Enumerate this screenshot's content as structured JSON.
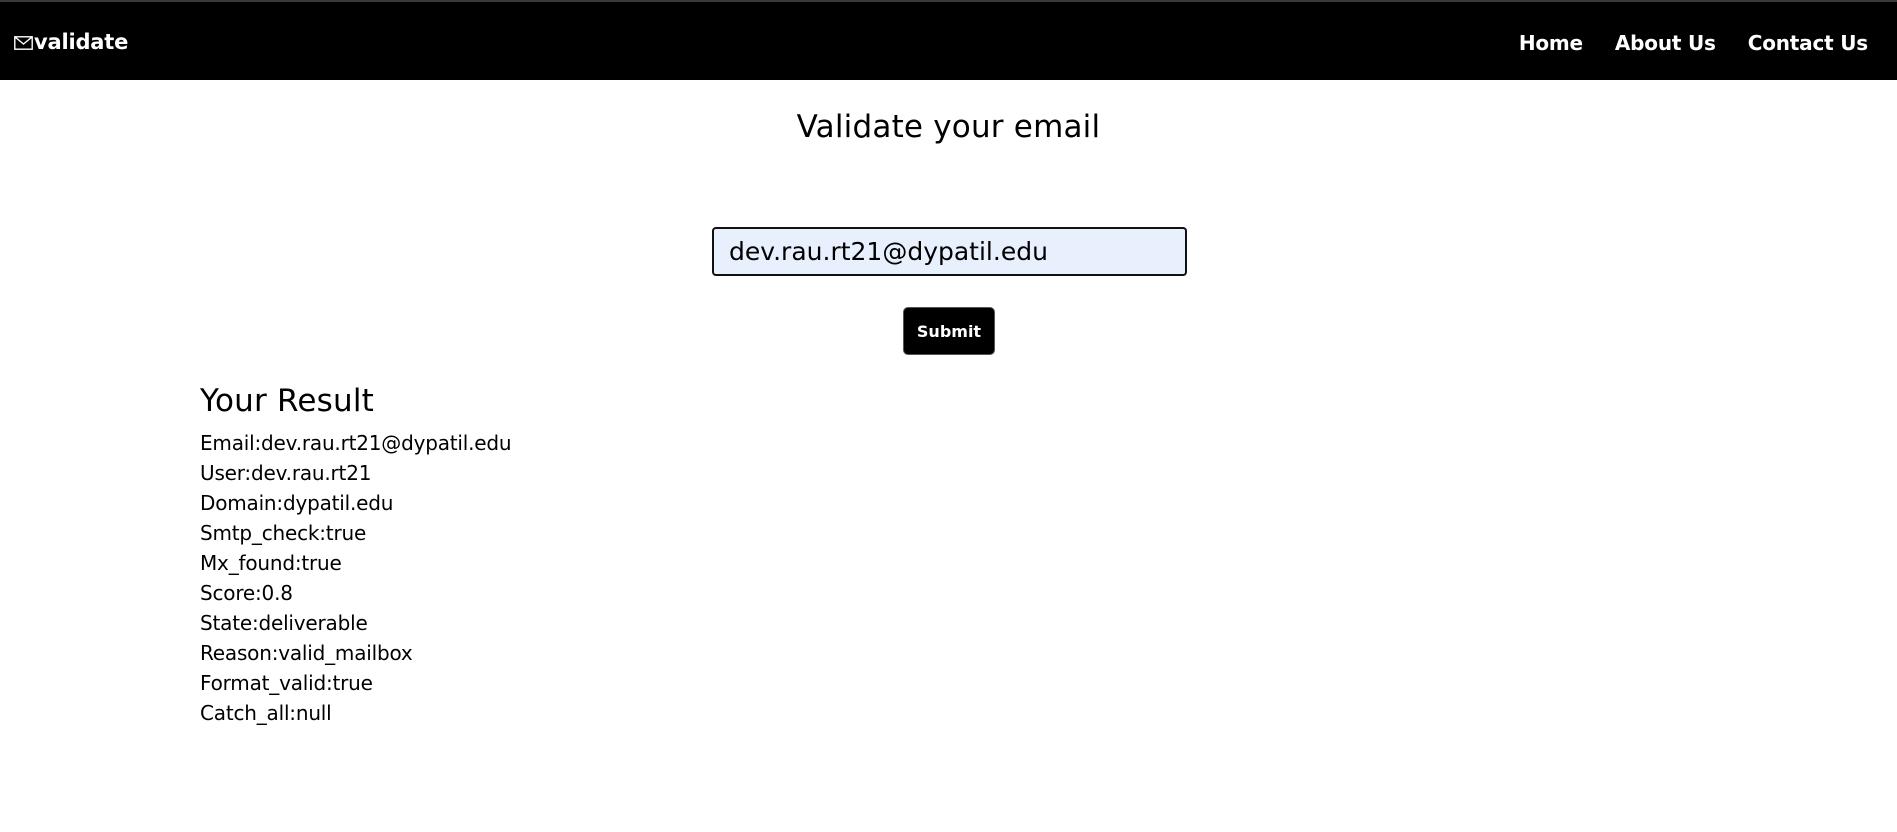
{
  "navbar": {
    "brand_label": "validate",
    "brand_icon": "envelope-icon",
    "links": [
      "Home",
      "About Us",
      "Contact Us"
    ]
  },
  "main": {
    "title": "Validate your email",
    "email_input_value": "dev.rau.rt21@dypatil.edu",
    "submit_label": "Submit"
  },
  "result": {
    "heading": "Your Result",
    "lines": [
      "Email:dev.rau.rt21@dypatil.edu",
      "User:dev.rau.rt21",
      "Domain:dypatil.edu",
      "Smtp_check:true",
      "Mx_found:true",
      "Score:0.8",
      "State:deliverable",
      "Reason:valid_mailbox",
      "Format_valid:true",
      "Catch_all:null"
    ]
  },
  "colors": {
    "navbar_bg": "#000000",
    "input_bg": "#e8f0fe",
    "button_bg": "#000000"
  }
}
